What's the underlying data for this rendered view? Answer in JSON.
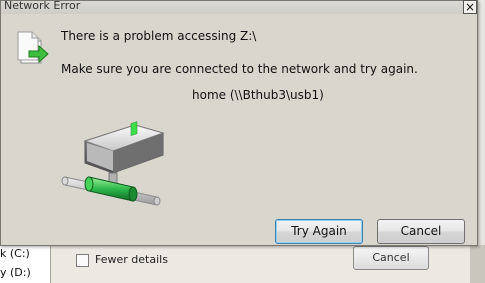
{
  "dialog": {
    "title": "Network Error",
    "close_glyph": "×",
    "message_line1": "There is a problem accessing Z:\\",
    "message_line2": "Make sure you are connected to the network and try again.",
    "network_path": "home (\\\\Bthub3\\usb1)",
    "buttons": {
      "try_again": "Try Again",
      "cancel": "Cancel"
    },
    "icons": {
      "header": "document-arrow-icon",
      "drive": "network-drive-icon"
    }
  },
  "background_window": {
    "drive_c": "k (C:)",
    "drive_d": "y (D:)",
    "fewer_details": "Fewer details",
    "cancel": "Cancel"
  },
  "colors": {
    "dialog_bg": "#d9d6ce",
    "focus_blue": "#3c7fb1",
    "network_green": "#2db84a"
  }
}
